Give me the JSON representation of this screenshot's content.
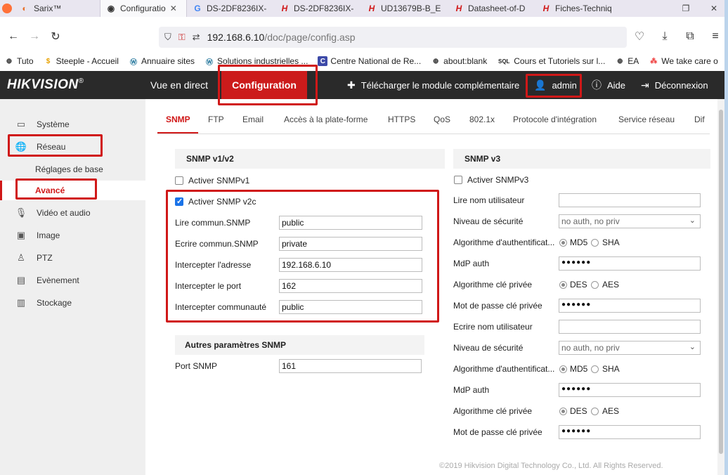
{
  "browser": {
    "tabs": [
      {
        "title": "Sarix™",
        "favicon": "firefox-icon"
      },
      {
        "title": "Configuratio",
        "favicon": "camera-icon",
        "active": true
      },
      {
        "title": "DS-2DF8236IX-",
        "favicon": "google-icon"
      },
      {
        "title": "DS-2DF8236IX-",
        "favicon": "hikvision-h-icon"
      },
      {
        "title": "UD13679B-B_E",
        "favicon": "hikvision-h-icon"
      },
      {
        "title": "Datasheet-of-D",
        "favicon": "hikvision-h-icon"
      },
      {
        "title": "Fiches-Techniq",
        "favicon": "hikvision-h-icon"
      }
    ],
    "url_host": "192.168.6.10",
    "url_path": "/doc/page/config.asp",
    "bookmarks": [
      {
        "label": "Tuto",
        "icon": "globe-icon"
      },
      {
        "label": "Steeple - Accueil",
        "icon": "steeple-icon"
      },
      {
        "label": "Annuaire sites",
        "icon": "wordpress-icon"
      },
      {
        "label": "Solutions industrielles ...",
        "icon": "wordpress-icon"
      },
      {
        "label": "Centre National de Re...",
        "icon": "page-icon"
      },
      {
        "label": "about:blank",
        "icon": "globe-icon"
      },
      {
        "label": "Cours et Tutoriels sur l...",
        "icon": "sql-icon"
      },
      {
        "label": "EA",
        "icon": "globe-icon"
      },
      {
        "label": "We take care o",
        "icon": "grid-icon"
      }
    ]
  },
  "header": {
    "logo": "HIKVISION",
    "logo_mark": "®",
    "nav_live": "Vue en direct",
    "nav_config": "Configuration",
    "download_plugin": "Télécharger le module complémentaire",
    "user": "admin",
    "help": "Aide",
    "logout": "Déconnexion"
  },
  "sidebar": {
    "system": "Système",
    "network": "Réseau",
    "basic_settings": "Réglages de base",
    "advanced": "Avancé",
    "video_audio": "Vidéo et audio",
    "image": "Image",
    "ptz": "PTZ",
    "events": "Evènement",
    "storage": "Stockage"
  },
  "tabs": [
    "SNMP",
    "FTP",
    "Email",
    "Accès à la plate-forme",
    "HTTPS",
    "QoS",
    "802.1x",
    "Protocole d'intégration",
    "Service réseau",
    "Dif"
  ],
  "snmp_v1v2": {
    "title": "SNMP v1/v2",
    "enable_v1_label": "Activer SNMPv1",
    "enable_v1_checked": false,
    "enable_v2c_label": "Activer SNMP v2c",
    "enable_v2c_checked": true,
    "read_community_label": "Lire commun.SNMP",
    "read_community": "public",
    "write_community_label": "Ecrire commun.SNMP",
    "write_community": "private",
    "trap_address_label": "Intercepter l'adresse",
    "trap_address": "192.168.6.10",
    "trap_port_label": "Intercepter le port",
    "trap_port": "162",
    "trap_community_label": "Intercepter communauté",
    "trap_community": "public"
  },
  "other_snmp": {
    "title": "Autres paramètres SNMP",
    "port_label": "Port SNMP",
    "port": "161"
  },
  "snmp_v3": {
    "title": "SNMP v3",
    "enable_v3_label": "Activer SNMPv3",
    "enable_v3_checked": false,
    "read_user_label": "Lire nom utilisateur",
    "read_user": "",
    "security_level_label": "Niveau de sécurité",
    "security_level": "no auth, no priv",
    "auth_algo_label": "Algorithme d'authentificat...",
    "md5": "MD5",
    "sha": "SHA",
    "auth_pwd_label": "MdP auth",
    "auth_pwd": "●●●●●●",
    "priv_algo_label": "Algorithme clé privée",
    "des": "DES",
    "aes": "AES",
    "priv_pwd_label": "Mot de passe clé privée",
    "priv_pwd": "●●●●●●",
    "write_user_label": "Ecrire nom utilisateur",
    "write_user": "",
    "security_level2": "no auth, no priv",
    "auth_pwd2": "●●●●●●",
    "priv_pwd2": "●●●●●●"
  },
  "footer": "©2019 Hikvision Digital Technology Co., Ltd. All Rights Reserved.",
  "colors": {
    "accent": "#d01818",
    "header_bg": "#2a2a2a",
    "sidebar_bg": "#efefef"
  }
}
